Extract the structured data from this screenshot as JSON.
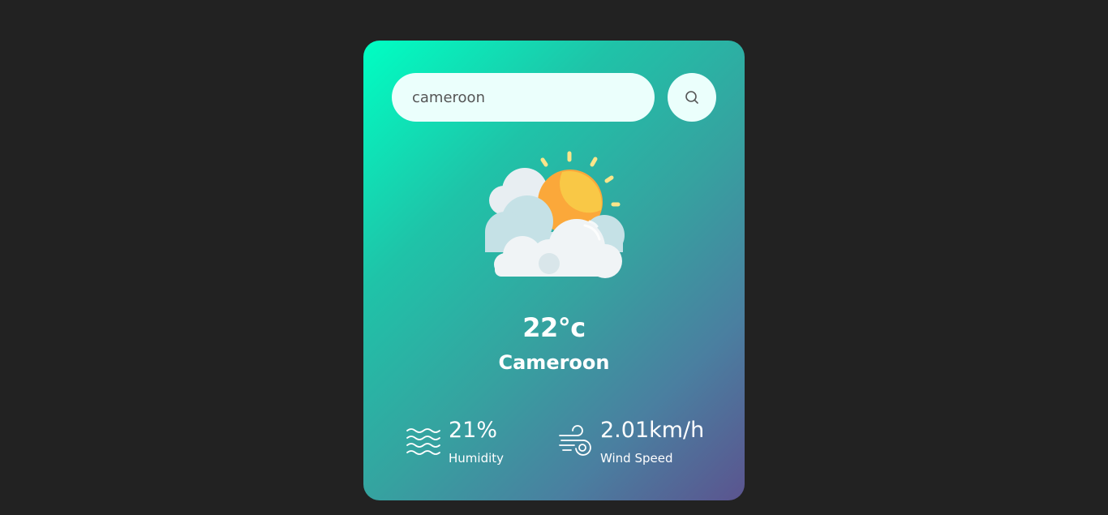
{
  "search": {
    "value": "cameroon",
    "button_icon": "search-icon"
  },
  "weather": {
    "icon": "partly-cloudy-icon",
    "temperature": "22°c",
    "city": "Cameroon"
  },
  "details": {
    "humidity": {
      "icon": "humidity-icon",
      "value": "21%",
      "label": "Humidity"
    },
    "wind": {
      "icon": "wind-icon",
      "value": "2.01km/h",
      "label": "Wind Speed"
    }
  },
  "colors": {
    "background": "#222222",
    "gradient_start": "#00ffc3",
    "gradient_end": "#5b548f",
    "input_bg": "#ebfffc",
    "sun": "#f9c846",
    "cloud": "#f0f4f6"
  }
}
